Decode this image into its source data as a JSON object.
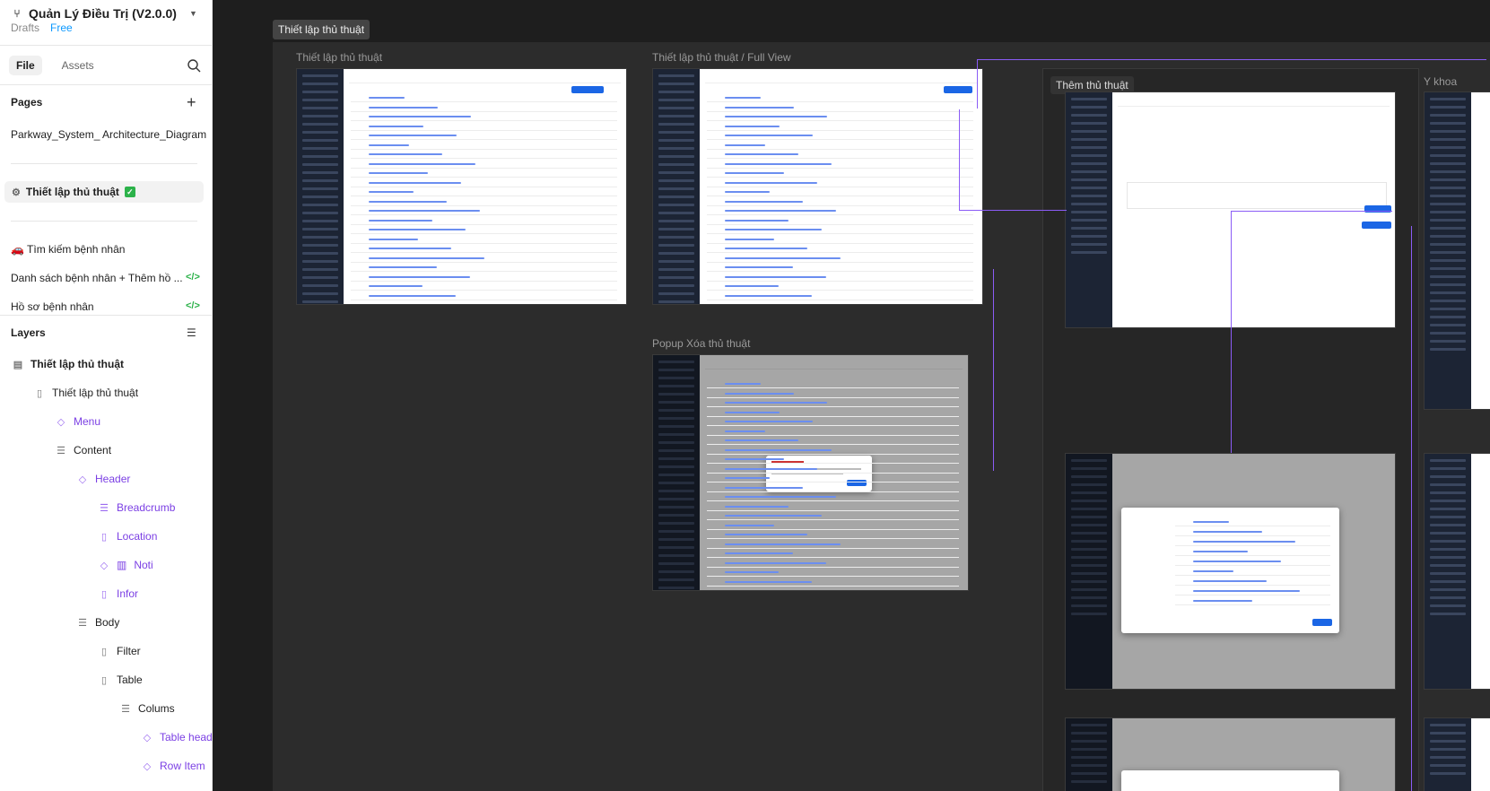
{
  "project": {
    "title": "Quản Lý Điều Trị (V2.0.0)",
    "drafts_label": "Drafts",
    "plan_label": "Free"
  },
  "tabs": {
    "file": "File",
    "assets": "Assets"
  },
  "pages": {
    "title": "Pages",
    "items": [
      {
        "label": "Parkway_System_ Architecture_Diagram"
      },
      {
        "label": "Thiết lập thủ thuật"
      },
      {
        "label": "🚗 Tìm kiếm bệnh nhân"
      },
      {
        "label": "Danh sách bệnh nhân + Thêm hồ ..."
      },
      {
        "label": "Hồ sơ bệnh nhân"
      }
    ]
  },
  "layers": {
    "title": "Layers",
    "items": [
      {
        "label": "Thiết lập thủ thuật"
      },
      {
        "label": "Thiết lập thủ thuật"
      },
      {
        "label": "Menu"
      },
      {
        "label": "Content"
      },
      {
        "label": "Header"
      },
      {
        "label": "Breadcrumb"
      },
      {
        "label": "Location"
      },
      {
        "label": "Noti"
      },
      {
        "label": "Infor"
      },
      {
        "label": "Body"
      },
      {
        "label": "Filter"
      },
      {
        "label": "Table"
      },
      {
        "label": "Colums"
      },
      {
        "label": "Table head"
      },
      {
        "label": "Row Item"
      }
    ]
  },
  "canvas": {
    "section_label": "Thiết lập thủ thuật",
    "frames": {
      "main": "Thiết lập thủ thuật",
      "full": "Thiết lập thủ thuật / Full View",
      "popup": "Popup Xóa thủ thuật",
      "add": "Thêm thủ thuật",
      "ykhoa": "Y khoa"
    }
  },
  "colors": {
    "accent": "#0d99ff",
    "purple": "#7b3fe4",
    "green": "#2cb24a"
  }
}
